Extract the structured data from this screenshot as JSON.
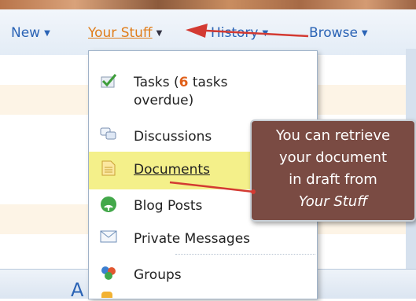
{
  "nav": {
    "new_label": "New",
    "your_stuff_label": "Your Stuff",
    "history_label": "History",
    "browse_label": "Browse"
  },
  "menu": {
    "tasks_label": "Tasks (",
    "tasks_count": "6",
    "tasks_suffix": " tasks",
    "tasks_line2": "overdue)",
    "discussions_label": "Discussions",
    "documents_label": "Documents",
    "blog_posts_label": "Blog Posts",
    "private_messages_label": "Private Messages",
    "groups_label": "Groups"
  },
  "callout": {
    "line1": "You can retrieve",
    "line2": "your document",
    "line3": "in draft from",
    "line4": "Your Stuff"
  },
  "bottom": {
    "letter": "A"
  },
  "colors": {
    "link_blue": "#2a63b5",
    "active_orange": "#e07d1a",
    "callout_bg": "#7a4b43",
    "arrow_red": "#d33a32",
    "highlight_yellow": "#f4f08a"
  },
  "icons": [
    "checkmark-icon",
    "speech-bubbles-icon",
    "document-icon",
    "blog-feed-icon",
    "envelope-icon",
    "groups-icon",
    "caret-down-icon"
  ]
}
